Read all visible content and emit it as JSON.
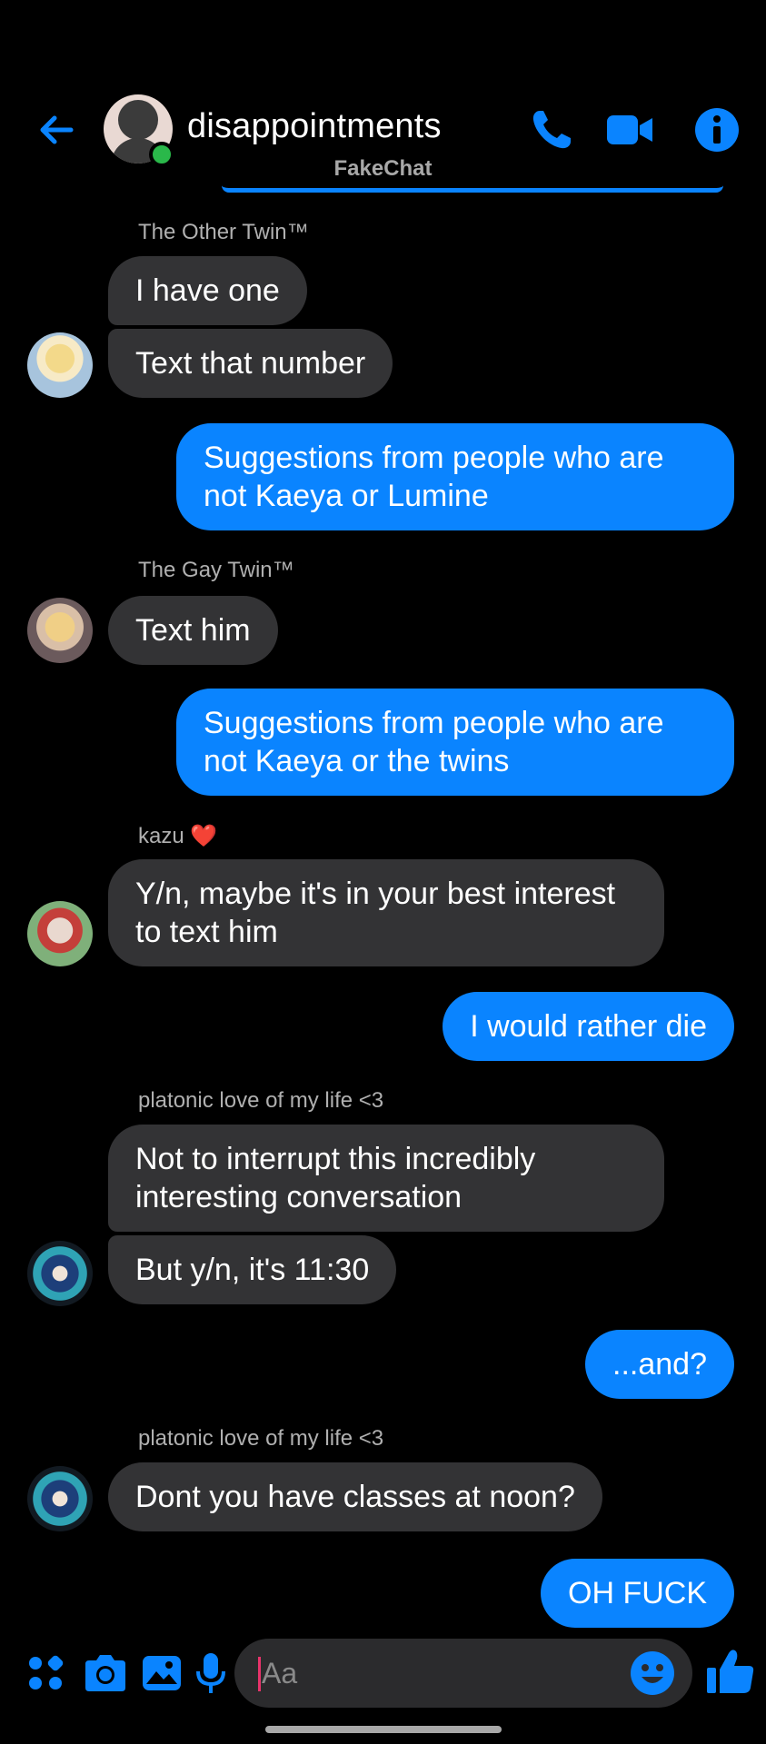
{
  "header": {
    "title": "disappointments",
    "watermark": "FakeChat",
    "icons": [
      "back-arrow-icon",
      "phone-icon",
      "video-camera-icon",
      "info-icon"
    ],
    "accent_color": "#0a84ff",
    "online_color": "#2ab84a"
  },
  "messages": [
    {
      "type": "sender",
      "text": "The Other Twin™"
    },
    {
      "type": "in",
      "text": "I have one"
    },
    {
      "type": "in",
      "text": "Text that number"
    },
    {
      "type": "out",
      "text": "Suggestions from people who are not Kaeya or Lumine"
    },
    {
      "type": "sender",
      "text": "The Gay Twin™"
    },
    {
      "type": "in",
      "text": "Text him"
    },
    {
      "type": "out",
      "text": "Suggestions from people who are not Kaeya or the twins"
    },
    {
      "type": "sender",
      "text": "kazu ❤️"
    },
    {
      "type": "in",
      "text": "Y/n, maybe it's in your best interest to text him"
    },
    {
      "type": "out",
      "text": "I would rather die"
    },
    {
      "type": "sender",
      "text": "platonic love of my life <3"
    },
    {
      "type": "in",
      "text": "Not to interrupt this incredibly interesting conversation"
    },
    {
      "type": "in",
      "text": "But y/n, it's 11:30"
    },
    {
      "type": "out",
      "text": "...and?"
    },
    {
      "type": "sender",
      "text": "platonic love of my life <3"
    },
    {
      "type": "in",
      "text": "Dont you have classes at noon?"
    },
    {
      "type": "out",
      "text": "OH FUCK"
    }
  ],
  "composer": {
    "placeholder": "Aa",
    "icons": [
      "apps-grid-icon",
      "camera-icon",
      "gallery-icon",
      "microphone-icon",
      "emoji-icon",
      "thumbs-up-icon"
    ]
  },
  "colors": {
    "background": "#000000",
    "incoming_bubble": "#333335",
    "outgoing_bubble": "#0a84ff",
    "sender_name": "#b0b0b0"
  }
}
